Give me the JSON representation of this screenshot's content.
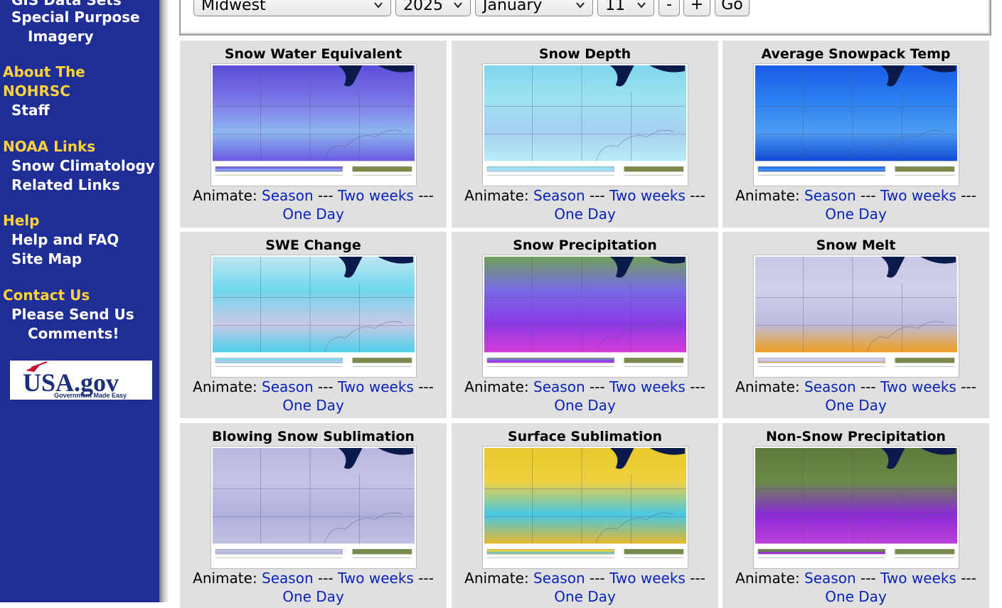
{
  "sidebar": {
    "links_top": [
      {
        "label": "GIS Data Sets"
      },
      {
        "label": "Special Purpose",
        "label2": "Imagery"
      }
    ],
    "sections": [
      {
        "heading": "About The",
        "heading2": "NOHRSC",
        "items": [
          {
            "label": "Staff"
          }
        ]
      },
      {
        "heading": "NOAA Links",
        "items": [
          {
            "label": "Snow Climatology"
          },
          {
            "label": "Related Links"
          }
        ]
      },
      {
        "heading": "Help",
        "items": [
          {
            "label": "Help and FAQ"
          },
          {
            "label": "Site Map"
          }
        ]
      },
      {
        "heading": "Contact Us",
        "items": [
          {
            "label": "Please Send Us",
            "label2": "Comments!"
          }
        ]
      }
    ],
    "logo": {
      "main": "USA.gov",
      "tagline": "Government Made Easy"
    }
  },
  "controls": {
    "region": "Midwest",
    "year": "2025",
    "month": "January",
    "day": "11",
    "minus": "-",
    "plus": "+",
    "go": "Go"
  },
  "animate": {
    "prefix": "Animate:",
    "season": "Season",
    "sep": "---",
    "two_weeks": "Two weeks",
    "one_day": "One Day"
  },
  "products": [
    {
      "title": "Snow Water Equivalent",
      "palette": [
        "#5a4fd8",
        "#7b73e6",
        "#8fb6f0",
        "#6a5ae0"
      ]
    },
    {
      "title": "Snow Depth",
      "palette": [
        "#7fd6ec",
        "#9de3f2",
        "#a6d0f0",
        "#b9ecf6"
      ]
    },
    {
      "title": "Average Snowpack Temp",
      "palette": [
        "#1a5ce6",
        "#2a7ef0",
        "#4b9cf2",
        "#1349d4"
      ]
    },
    {
      "title": "SWE Change",
      "palette": [
        "#bfe6f2",
        "#6fd7ec",
        "#c9c9e6",
        "#4cd0ea"
      ]
    },
    {
      "title": "Snow Precipitation",
      "palette": [
        "#6fa05a",
        "#7a6ae6",
        "#8a3ae6",
        "#d63ad6"
      ]
    },
    {
      "title": "Snow Melt",
      "palette": [
        "#c8c8e6",
        "#d0d0ea",
        "#bcbce0",
        "#f0a020"
      ]
    },
    {
      "title": "Blowing Snow Sublimation",
      "palette": [
        "#b8b8e0",
        "#c4c4e8",
        "#b0b0dc",
        "#c0c0e4"
      ]
    },
    {
      "title": "Surface Sublimation",
      "palette": [
        "#e8c82a",
        "#f0d040",
        "#46c8e6",
        "#e8b82a"
      ]
    },
    {
      "title": "Non-Snow Precipitation",
      "palette": [
        "#5f7a3c",
        "#6a8a46",
        "#8a2ad6",
        "#c040d8"
      ]
    }
  ],
  "colors": {
    "sidebar_bg": "#1f2d96",
    "heading": "#ffd23c",
    "link": "#0a24b8",
    "cell_bg": "#e0e0e0"
  }
}
